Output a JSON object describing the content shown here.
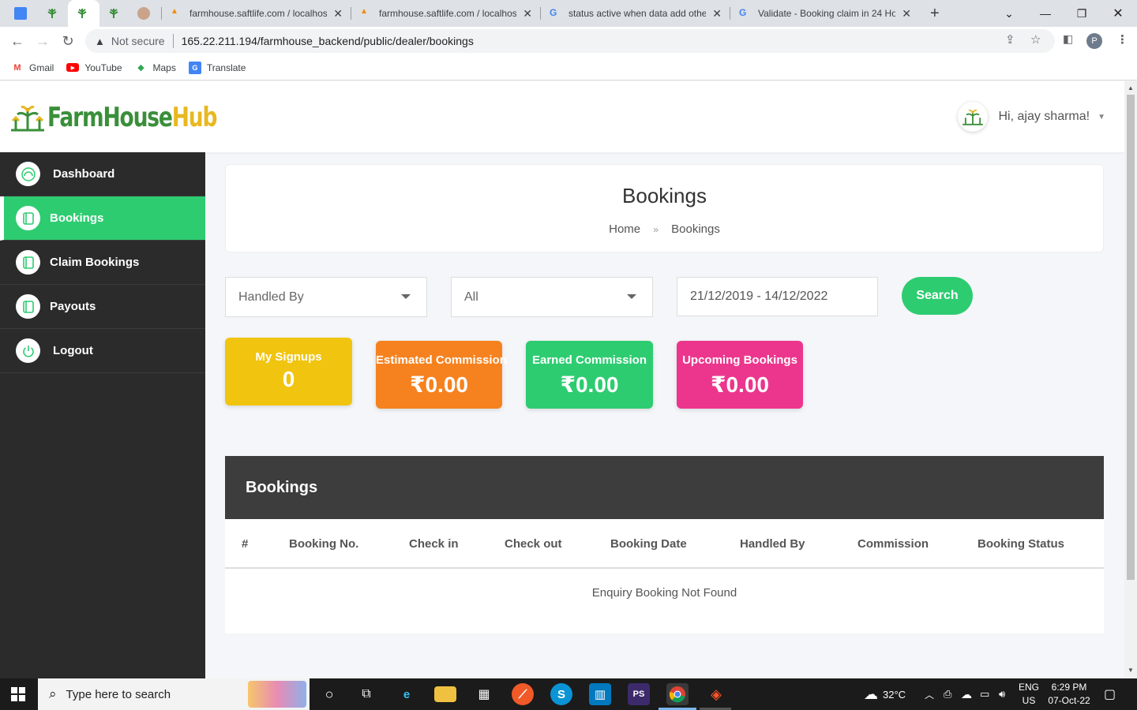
{
  "browser": {
    "tabs": [
      {
        "title": ""
      },
      {
        "title": ""
      },
      {
        "title": ""
      },
      {
        "title": ""
      },
      {
        "title": ""
      },
      {
        "title": "farmhouse.saftlife.com / localhos"
      },
      {
        "title": "farmhouse.saftlife.com / localhos"
      },
      {
        "title": "status active when data add othe"
      },
      {
        "title": "Validate - Booking claim in 24 Ho"
      }
    ],
    "security_label": "Not secure",
    "url": "165.22.211.194/farmhouse_backend/public/dealer/bookings",
    "profile_initial": "P",
    "bookmarks": [
      {
        "label": "Gmail",
        "icon": "gmail-icon"
      },
      {
        "label": "YouTube",
        "icon": "youtube-icon"
      },
      {
        "label": "Maps",
        "icon": "maps-icon"
      },
      {
        "label": "Translate",
        "icon": "translate-icon"
      }
    ]
  },
  "app": {
    "logo": {
      "part1": "FarmHouse",
      "part2": "Hub"
    },
    "user_greeting": "Hi, ajay sharma!",
    "sidebar": [
      {
        "label": "Dashboard",
        "icon": "dashboard-icon",
        "active": false
      },
      {
        "label": "Bookings",
        "icon": "notebook-icon",
        "active": true
      },
      {
        "label": "Claim Bookings",
        "icon": "notebook-icon",
        "active": false
      },
      {
        "label": "Payouts",
        "icon": "notebook-icon",
        "active": false
      },
      {
        "label": "Logout",
        "icon": "power-icon",
        "active": false
      }
    ],
    "page_title": "Bookings",
    "breadcrumb": {
      "home": "Home",
      "current": "Bookings"
    },
    "filters": {
      "handled_by": "Handled By",
      "status": "All",
      "date_range": "21/12/2019 - 14/12/2022",
      "search_label": "Search"
    },
    "stats": [
      {
        "label": "My Signups",
        "value": "0",
        "color": "#f1c40f"
      },
      {
        "label": "Estimated Commission",
        "value": "₹0.00",
        "color": "#f6821f"
      },
      {
        "label": "Earned Commission",
        "value": "₹0.00",
        "color": "#2ecc71"
      },
      {
        "label": "Upcoming Bookings",
        "value": "₹0.00",
        "color": "#ec368d"
      }
    ],
    "table": {
      "title": "Bookings",
      "columns": [
        "#",
        "Booking No.",
        "Check in",
        "Check out",
        "Booking Date",
        "Handled By",
        "Commission",
        "Booking Status"
      ],
      "empty_message": "Enquiry Booking Not Found"
    }
  },
  "taskbar": {
    "search_placeholder": "Type here to search",
    "weather": "32°C",
    "lang1": "ENG",
    "lang2": "US",
    "time": "6:29 PM",
    "date": "07-Oct-22"
  },
  "colors": {
    "accent_green": "#2ecc71",
    "sidebar_bg": "#2b2b2b",
    "table_header_bg": "#3d3d3d"
  }
}
